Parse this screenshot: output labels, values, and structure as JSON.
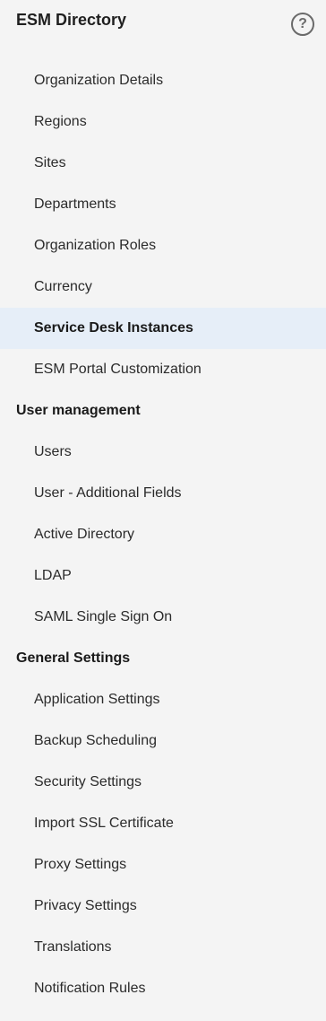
{
  "header": {
    "title": "ESM Directory",
    "help_glyph": "?",
    "help_icon": "help-circle-icon"
  },
  "menu": {
    "esm_directory": [
      "Organization Details",
      "Regions",
      "Sites",
      "Departments",
      "Organization Roles",
      "Currency",
      "Service Desk Instances",
      "ESM Portal Customization"
    ],
    "user_management": {
      "title": "User management",
      "items": [
        "Users",
        "User - Additional Fields",
        "Active Directory",
        "LDAP",
        "SAML Single Sign On"
      ]
    },
    "general_settings": {
      "title": "General Settings",
      "items": [
        "Application Settings",
        "Backup Scheduling",
        "Security Settings",
        "Import SSL Certificate",
        "Proxy Settings",
        "Privacy Settings",
        "Translations",
        "Notification Rules"
      ]
    },
    "active_item": "Service Desk Instances"
  },
  "colors": {
    "background": "#f4f4f4",
    "active_background": "#e6eef8"
  }
}
